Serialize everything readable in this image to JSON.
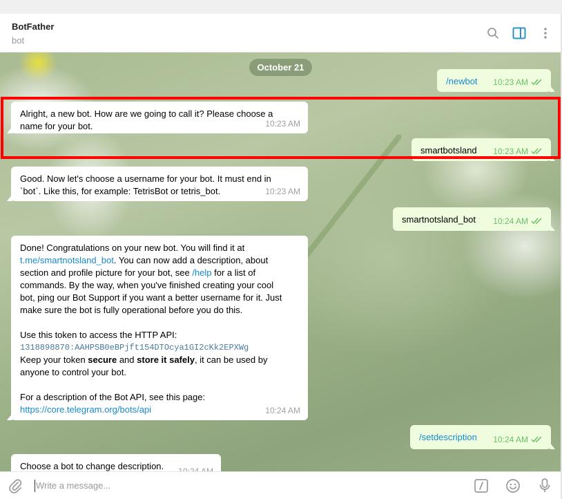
{
  "header": {
    "title": "BotFather",
    "subtitle": "bot",
    "icons": [
      "search-icon",
      "sidebar-panel-icon",
      "more-vertical-icon"
    ]
  },
  "chat": {
    "date_chip": "October 21",
    "messages": [
      {
        "dir": "out",
        "text": "/newbot",
        "time": "10:23 AM"
      },
      {
        "dir": "in",
        "line1": "Alright, a new bot. How are we going to call it? Please choose a",
        "line2": "name for your bot.",
        "time": "10:23 AM"
      },
      {
        "dir": "out",
        "text": "smartbotsland",
        "time": "10:23 AM"
      },
      {
        "dir": "in",
        "line1": "Good. Now let's choose a username for your bot. It must end in",
        "line2": "`bot`. Like this, for example: TetrisBot or tetris_bot.",
        "time": "10:23 AM"
      },
      {
        "dir": "out",
        "text": "smartnotsland_bot",
        "time": "10:24 AM"
      },
      {
        "dir": "in",
        "l1": "Done! Congratulations on your new bot. You will find it at",
        "l2_link": "t.me/smartnotsland_bot",
        "l2_rest": ". You can now add a description, about",
        "l3_a": "section and profile picture for your bot, see ",
        "l3_link": "/help",
        "l3_b": " for a list of",
        "l4": "commands. By the way, when you've finished creating your cool",
        "l5": "bot, ping our Bot Support if you want a better username for it. Just",
        "l6": "make sure the bot is fully operational before you do this.",
        "l7": "Use this token to access the HTTP API:",
        "token": "1318898870:AAHPSB0eBPjft154DTOcya1GI2cKk2EPXWg",
        "l9_a": "Keep your token ",
        "l9_b1": "secure",
        "l9_c": " and ",
        "l9_b2": "store it safely",
        "l9_d": ", it can be used by",
        "l10": "anyone to control your bot.",
        "l11": "For a description of the Bot API, see this page:",
        "l12_link": "https://core.telegram.org/bots/api",
        "time": "10:24 AM"
      },
      {
        "dir": "out",
        "text": "/setdescription",
        "time": "10:24 AM"
      },
      {
        "dir": "in",
        "text": "Choose a bot to change description.",
        "time": "10:24 AM"
      }
    ]
  },
  "composer": {
    "placeholder": "Write a message...",
    "icons": [
      "attach-icon",
      "bot-command-icon",
      "emoji-icon",
      "microphone-icon"
    ]
  },
  "colors": {
    "accent": "#168acd",
    "outgoing_bubble": "#effdde",
    "read_check": "#6cbf68",
    "highlight_box": "#ff0000"
  }
}
